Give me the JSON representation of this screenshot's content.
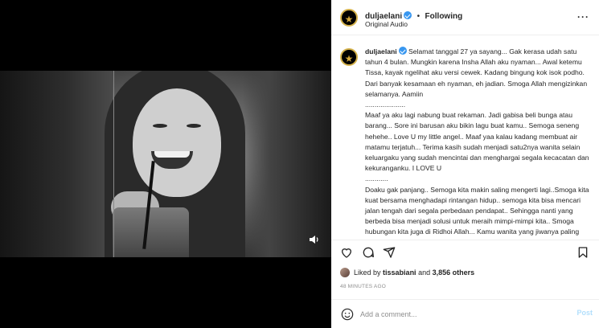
{
  "post": {
    "username": "duljaelani",
    "separator": "•",
    "following_label": "Following",
    "audio": "Original Audio",
    "more_icon": "ellipsis-icon"
  },
  "caption": {
    "username": "duljaelani",
    "text": "Selamat tanggal 27 ya sayang... Gak kerasa udah satu tahun 4 bulan. Mungkin karena Insha Allah aku nyaman... Awal ketemu Tissa, kayak ngelihat aku versi cewek. Kadang bingung kok isok podho. Dari banyak kesamaan eh nyaman, eh jadian. Smoga Allah mengizinkan selamanya. Aamiin\n.....................\nMaaf ya aku lagi nabung buat rekaman. Jadi gabisa beli bunga atau barang... Sore ini barusan aku bikin lagu buat kamu.. Semoga seneng hehehe.. Love U my little angel.. Maaf yaa kalau kadang membuat air matamu terjatuh... Terima kasih sudah menjadi satu2nya wanita selain keluargaku yang sudah mencintai dan menghargai segala kecacatan dan kekuranganku. I LOVE U\n............\nDoaku gak panjang.. Semoga kita makin saling mengerti lagi..Smoga kita kuat bersama menghadapi rintangan hidup.. semoga kita bisa mencari jalan tengah dari segala perbedaan pendapat.. Sehingga nanti yang berbeda bisa menjadi solusi untuk meraih mimpi-mimpi kita.. Smoga hubungan kita juga di Ridhoi Allah... Kamu wanita yang jiwanya paling indah yg pernah aku"
  },
  "likes": {
    "prefix": "Liked by",
    "user": "tissabiani",
    "conjunction": "and",
    "others": "3,856 others"
  },
  "timestamp": "48 MINUTES AGO",
  "comment_box": {
    "placeholder": "Add a comment...",
    "post_label": "Post"
  },
  "colors": {
    "verified": "#3897f0",
    "post_button_disabled": "#b2dffc",
    "avatar_ring": "#d4b14a"
  },
  "icons": [
    "heart-icon",
    "comment-icon",
    "share-icon",
    "save-icon",
    "emoji-icon",
    "volume-icon",
    "verified-icon"
  ]
}
